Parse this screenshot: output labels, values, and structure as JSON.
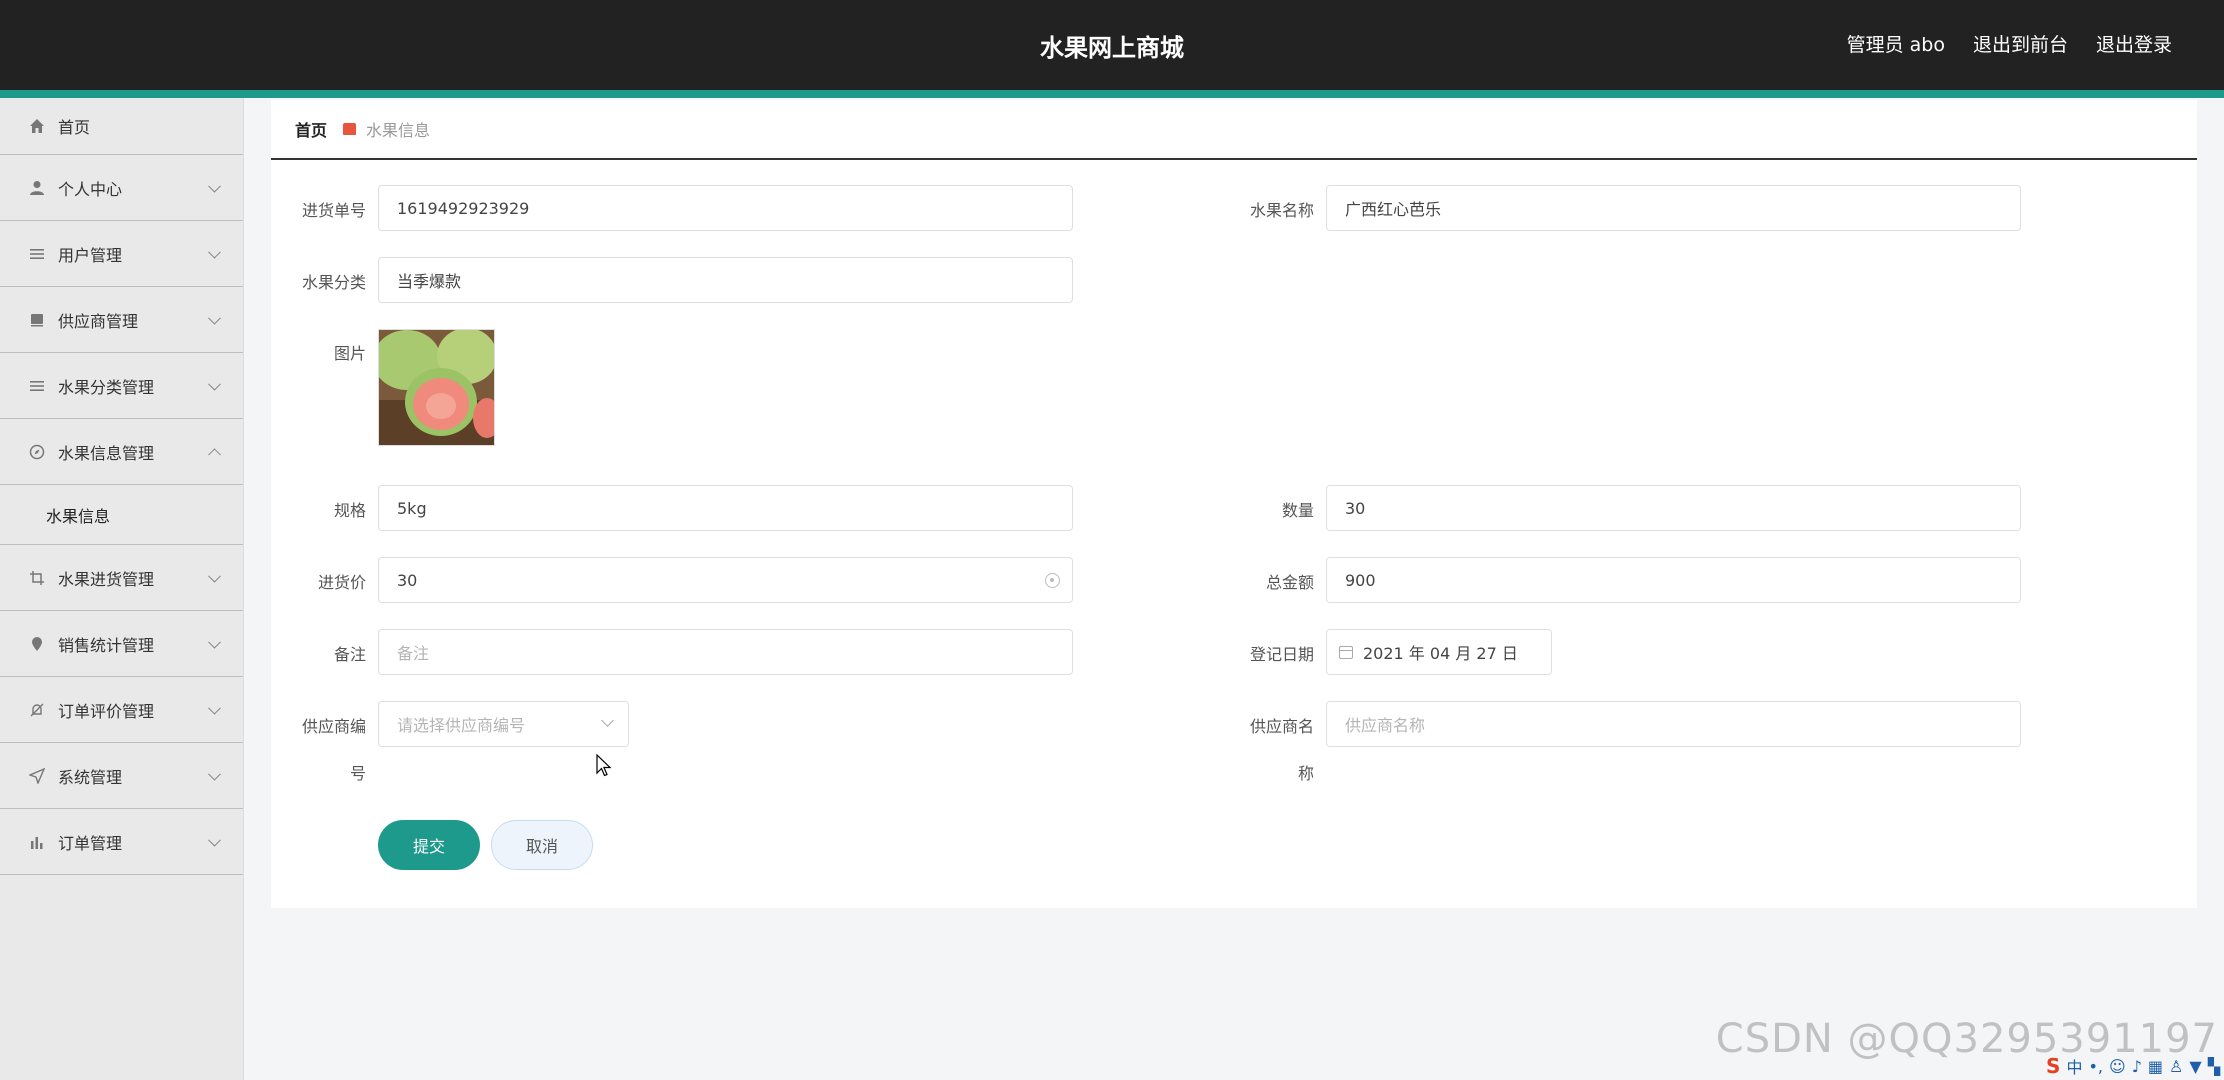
{
  "header": {
    "title": "水果网上商城",
    "links": [
      "管理员 abo",
      "退出到前台",
      "退出登录"
    ]
  },
  "sidebar": {
    "items": [
      {
        "label": "首页",
        "icon": "home-icon"
      },
      {
        "label": "个人中心",
        "icon": "user-icon"
      },
      {
        "label": "用户管理",
        "icon": "list-icon"
      },
      {
        "label": "供应商管理",
        "icon": "box-icon"
      },
      {
        "label": "水果分类管理",
        "icon": "list-icon"
      },
      {
        "label": "水果信息管理",
        "icon": "compass-icon",
        "expanded": true
      },
      {
        "label": "水果进货管理",
        "icon": "crop-icon"
      },
      {
        "label": "销售统计管理",
        "icon": "pin-icon"
      },
      {
        "label": "订单评价管理",
        "icon": "bell-off-icon"
      },
      {
        "label": "系统管理",
        "icon": "send-icon"
      },
      {
        "label": "订单管理",
        "icon": "bar-chart-icon"
      }
    ],
    "submenu": {
      "label": "水果信息"
    }
  },
  "breadcrumb": {
    "home": "首页",
    "current": "水果信息"
  },
  "form": {
    "purchase_no": {
      "label": "进货单号",
      "value": "1619492923929"
    },
    "fruit_name": {
      "label": "水果名称",
      "value": "广西红心芭乐"
    },
    "category": {
      "label": "水果分类",
      "value": "当季爆款"
    },
    "image": {
      "label": "图片"
    },
    "spec": {
      "label": "规格",
      "value": "5kg"
    },
    "quantity": {
      "label": "数量",
      "value": "30"
    },
    "price": {
      "label": "进货价",
      "value": "30"
    },
    "total": {
      "label": "总金额",
      "value": "900"
    },
    "remark": {
      "label": "备注",
      "placeholder": "备注"
    },
    "reg_date": {
      "label": "登记日期",
      "value": "2021 年 04 月 27 日"
    },
    "supplier_no": {
      "label_a": "供应商编",
      "label_b": "号",
      "placeholder": "请选择供应商编号"
    },
    "supplier_name": {
      "label_a": "供应商名",
      "label_b": "称",
      "placeholder": "供应商名称"
    }
  },
  "buttons": {
    "submit": "提交",
    "cancel": "取消"
  },
  "watermark": "CSDN @QQ3295391197",
  "ime": {
    "s": "S",
    "lang": "中"
  },
  "colors": {
    "accent": "#1d9a8c",
    "header_bg": "#222222",
    "breadcrumb_icon": "#e8553e"
  }
}
